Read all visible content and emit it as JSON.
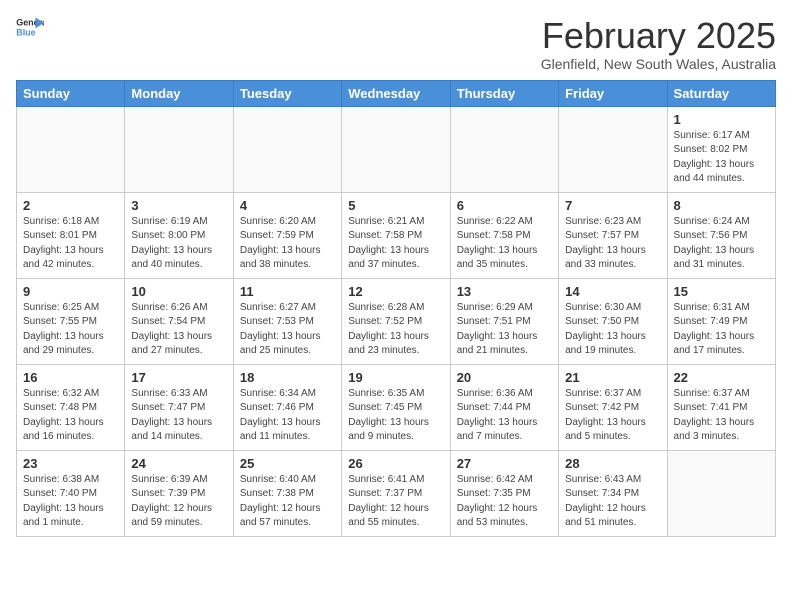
{
  "header": {
    "logo_general": "General",
    "logo_blue": "Blue",
    "month_title": "February 2025",
    "location": "Glenfield, New South Wales, Australia"
  },
  "weekdays": [
    "Sunday",
    "Monday",
    "Tuesday",
    "Wednesday",
    "Thursday",
    "Friday",
    "Saturday"
  ],
  "weeks": [
    [
      {
        "day": "",
        "info": ""
      },
      {
        "day": "",
        "info": ""
      },
      {
        "day": "",
        "info": ""
      },
      {
        "day": "",
        "info": ""
      },
      {
        "day": "",
        "info": ""
      },
      {
        "day": "",
        "info": ""
      },
      {
        "day": "1",
        "info": "Sunrise: 6:17 AM\nSunset: 8:02 PM\nDaylight: 13 hours\nand 44 minutes."
      }
    ],
    [
      {
        "day": "2",
        "info": "Sunrise: 6:18 AM\nSunset: 8:01 PM\nDaylight: 13 hours\nand 42 minutes."
      },
      {
        "day": "3",
        "info": "Sunrise: 6:19 AM\nSunset: 8:00 PM\nDaylight: 13 hours\nand 40 minutes."
      },
      {
        "day": "4",
        "info": "Sunrise: 6:20 AM\nSunset: 7:59 PM\nDaylight: 13 hours\nand 38 minutes."
      },
      {
        "day": "5",
        "info": "Sunrise: 6:21 AM\nSunset: 7:58 PM\nDaylight: 13 hours\nand 37 minutes."
      },
      {
        "day": "6",
        "info": "Sunrise: 6:22 AM\nSunset: 7:58 PM\nDaylight: 13 hours\nand 35 minutes."
      },
      {
        "day": "7",
        "info": "Sunrise: 6:23 AM\nSunset: 7:57 PM\nDaylight: 13 hours\nand 33 minutes."
      },
      {
        "day": "8",
        "info": "Sunrise: 6:24 AM\nSunset: 7:56 PM\nDaylight: 13 hours\nand 31 minutes."
      }
    ],
    [
      {
        "day": "9",
        "info": "Sunrise: 6:25 AM\nSunset: 7:55 PM\nDaylight: 13 hours\nand 29 minutes."
      },
      {
        "day": "10",
        "info": "Sunrise: 6:26 AM\nSunset: 7:54 PM\nDaylight: 13 hours\nand 27 minutes."
      },
      {
        "day": "11",
        "info": "Sunrise: 6:27 AM\nSunset: 7:53 PM\nDaylight: 13 hours\nand 25 minutes."
      },
      {
        "day": "12",
        "info": "Sunrise: 6:28 AM\nSunset: 7:52 PM\nDaylight: 13 hours\nand 23 minutes."
      },
      {
        "day": "13",
        "info": "Sunrise: 6:29 AM\nSunset: 7:51 PM\nDaylight: 13 hours\nand 21 minutes."
      },
      {
        "day": "14",
        "info": "Sunrise: 6:30 AM\nSunset: 7:50 PM\nDaylight: 13 hours\nand 19 minutes."
      },
      {
        "day": "15",
        "info": "Sunrise: 6:31 AM\nSunset: 7:49 PM\nDaylight: 13 hours\nand 17 minutes."
      }
    ],
    [
      {
        "day": "16",
        "info": "Sunrise: 6:32 AM\nSunset: 7:48 PM\nDaylight: 13 hours\nand 16 minutes."
      },
      {
        "day": "17",
        "info": "Sunrise: 6:33 AM\nSunset: 7:47 PM\nDaylight: 13 hours\nand 14 minutes."
      },
      {
        "day": "18",
        "info": "Sunrise: 6:34 AM\nSunset: 7:46 PM\nDaylight: 13 hours\nand 11 minutes."
      },
      {
        "day": "19",
        "info": "Sunrise: 6:35 AM\nSunset: 7:45 PM\nDaylight: 13 hours\nand 9 minutes."
      },
      {
        "day": "20",
        "info": "Sunrise: 6:36 AM\nSunset: 7:44 PM\nDaylight: 13 hours\nand 7 minutes."
      },
      {
        "day": "21",
        "info": "Sunrise: 6:37 AM\nSunset: 7:42 PM\nDaylight: 13 hours\nand 5 minutes."
      },
      {
        "day": "22",
        "info": "Sunrise: 6:37 AM\nSunset: 7:41 PM\nDaylight: 13 hours\nand 3 minutes."
      }
    ],
    [
      {
        "day": "23",
        "info": "Sunrise: 6:38 AM\nSunset: 7:40 PM\nDaylight: 13 hours\nand 1 minute."
      },
      {
        "day": "24",
        "info": "Sunrise: 6:39 AM\nSunset: 7:39 PM\nDaylight: 12 hours\nand 59 minutes."
      },
      {
        "day": "25",
        "info": "Sunrise: 6:40 AM\nSunset: 7:38 PM\nDaylight: 12 hours\nand 57 minutes."
      },
      {
        "day": "26",
        "info": "Sunrise: 6:41 AM\nSunset: 7:37 PM\nDaylight: 12 hours\nand 55 minutes."
      },
      {
        "day": "27",
        "info": "Sunrise: 6:42 AM\nSunset: 7:35 PM\nDaylight: 12 hours\nand 53 minutes."
      },
      {
        "day": "28",
        "info": "Sunrise: 6:43 AM\nSunset: 7:34 PM\nDaylight: 12 hours\nand 51 minutes."
      },
      {
        "day": "",
        "info": ""
      }
    ]
  ]
}
